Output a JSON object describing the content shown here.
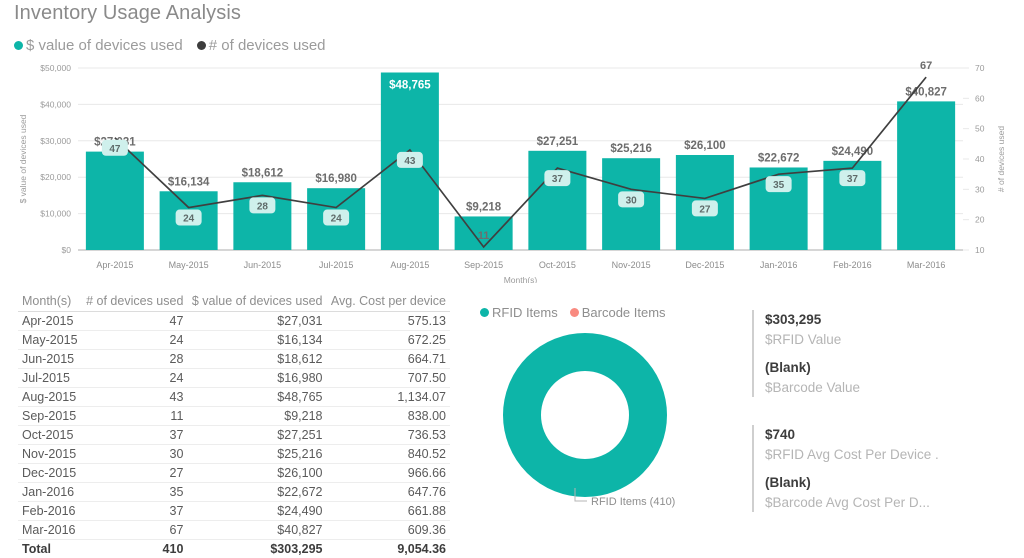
{
  "page": {
    "title": "Inventory Usage Analysis"
  },
  "theme": {
    "teal": "#0DB5A8",
    "line_dark": "#3f3f3f",
    "pill_bg": "#CFF0EC",
    "salmon": "#F98A80"
  },
  "combo_legend": [
    {
      "label": "$ value of devices used",
      "color": "#0DB5A8"
    },
    {
      "label": "# of devices used",
      "color": "#3d3d3d"
    }
  ],
  "donut_legend": [
    {
      "label": "RFID Items",
      "color": "#0DB5A8"
    },
    {
      "label": "Barcode Items",
      "color": "#F98A80"
    }
  ],
  "chart_data": [
    {
      "type": "bar",
      "title": "Inventory Usage Analysis",
      "xlabel": "Month(s)",
      "ylabel": "$ value of devices used",
      "y2label": "# of devices used",
      "ylim": [
        0,
        50000
      ],
      "y2lim": [
        10,
        70
      ],
      "yticks": [
        "$0",
        "$10,000",
        "$20,000",
        "$30,000",
        "$40,000",
        "$50,000"
      ],
      "y2ticks": [
        "10",
        "20",
        "30",
        "40",
        "50",
        "60",
        "70"
      ],
      "grid": true,
      "legend_position": "top-left",
      "categories": [
        "Apr-2015",
        "May-2015",
        "Jun-2015",
        "Jul-2015",
        "Aug-2015",
        "Sep-2015",
        "Oct-2015",
        "Nov-2015",
        "Dec-2015",
        "Jan-2016",
        "Feb-2016",
        "Mar-2016"
      ],
      "series": [
        {
          "name": "$ value of devices used",
          "type": "bar",
          "axis": "left",
          "values": [
            27031,
            16134,
            18612,
            16980,
            48765,
            9218,
            27251,
            25216,
            26100,
            22672,
            24490,
            40827
          ],
          "labels": [
            "$27,031",
            "$16,134",
            "$18,612",
            "$16,980",
            "$48,765",
            "$9,218",
            "$27,251",
            "$25,216",
            "$26,100",
            "$22,672",
            "$24,490",
            "$40,827"
          ]
        },
        {
          "name": "# of devices used",
          "type": "line",
          "axis": "right",
          "values": [
            47,
            24,
            28,
            24,
            43,
            11,
            37,
            30,
            27,
            35,
            37,
            67
          ],
          "labels": [
            "47",
            "24",
            "28",
            "24",
            "43",
            "11",
            "37",
            "30",
            "27",
            "35",
            "37",
            "67"
          ]
        }
      ]
    },
    {
      "type": "pie",
      "subtype": "donut",
      "categories": [
        "RFID Items",
        "Barcode Items"
      ],
      "values": [
        410,
        0
      ],
      "colors": [
        "#0DB5A8",
        "#F98A80"
      ],
      "callout": "RFID Items (410)",
      "legend_position": "top"
    },
    {
      "type": "table",
      "columns": [
        "Month(s)",
        "# of devices used",
        "$ value of devices used",
        "Avg. Cost per device"
      ],
      "rows": [
        [
          "Apr-2015",
          "47",
          "$27,031",
          "575.13"
        ],
        [
          "May-2015",
          "24",
          "$16,134",
          "672.25"
        ],
        [
          "Jun-2015",
          "28",
          "$18,612",
          "664.71"
        ],
        [
          "Jul-2015",
          "24",
          "$16,980",
          "707.50"
        ],
        [
          "Aug-2015",
          "43",
          "$48,765",
          "1,134.07"
        ],
        [
          "Sep-2015",
          "11",
          "$9,218",
          "838.00"
        ],
        [
          "Oct-2015",
          "37",
          "$27,251",
          "736.53"
        ],
        [
          "Nov-2015",
          "30",
          "$25,216",
          "840.52"
        ],
        [
          "Dec-2015",
          "27",
          "$26,100",
          "966.66"
        ],
        [
          "Jan-2016",
          "35",
          "$22,672",
          "647.76"
        ],
        [
          "Feb-2016",
          "37",
          "$24,490",
          "661.88"
        ],
        [
          "Mar-2016",
          "67",
          "$40,827",
          "609.36"
        ]
      ],
      "total_row": [
        "Total",
        "410",
        "$303,295",
        "9,054.36"
      ]
    }
  ],
  "kpis": [
    {
      "id": "value",
      "entries": [
        {
          "value": "$303,295",
          "label": "$RFID Value"
        },
        {
          "value": "(Blank)",
          "label": "$Barcode Value"
        }
      ]
    },
    {
      "id": "cost",
      "entries": [
        {
          "value": "$740",
          "label": "$RFID Avg Cost Per Device ."
        },
        {
          "value": "(Blank)",
          "label": "$Barcode Avg Cost Per D..."
        }
      ]
    }
  ]
}
